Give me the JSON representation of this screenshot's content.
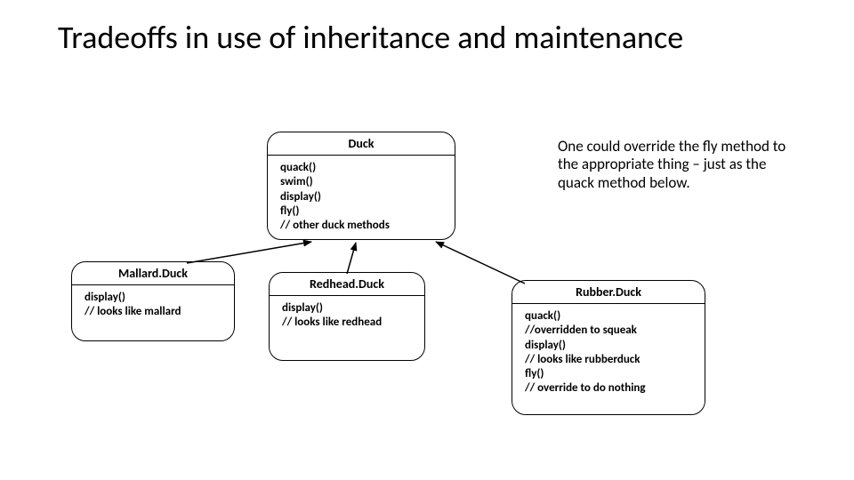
{
  "title": "Tradeoffs in use of inheritance and maintenance",
  "annotation": "One could override the fly method to the appropriate thing – just as the quack method below.",
  "classes": {
    "duck": {
      "name": "Duck",
      "body": "quack()\nswim()\ndisplay()\nfly()\n// other duck methods"
    },
    "mallard": {
      "name": "Mallard.Duck",
      "body": "display()\n// looks like mallard"
    },
    "redhead": {
      "name": "Redhead.Duck",
      "body": "display()\n// looks like redhead"
    },
    "rubber": {
      "name": "Rubber.Duck",
      "body": "quack()\n//overridden to squeak\ndisplay()\n// looks like rubberduck\nfly()\n// override to do nothing"
    }
  }
}
